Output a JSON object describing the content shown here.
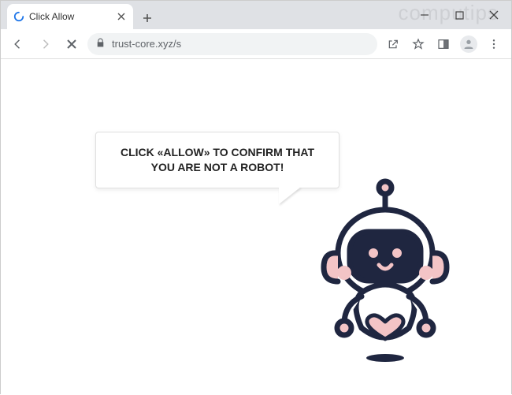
{
  "window": {
    "tab_title": "Click Allow",
    "url": "trust-core.xyz/s"
  },
  "watermark": "computips",
  "page": {
    "bubble_text": "CLICK «ALLOW» TO CONFIRM THAT YOU ARE NOT A ROBOT!"
  },
  "colors": {
    "robot_outline": "#1f2640",
    "robot_accent": "#f3c4c6"
  }
}
